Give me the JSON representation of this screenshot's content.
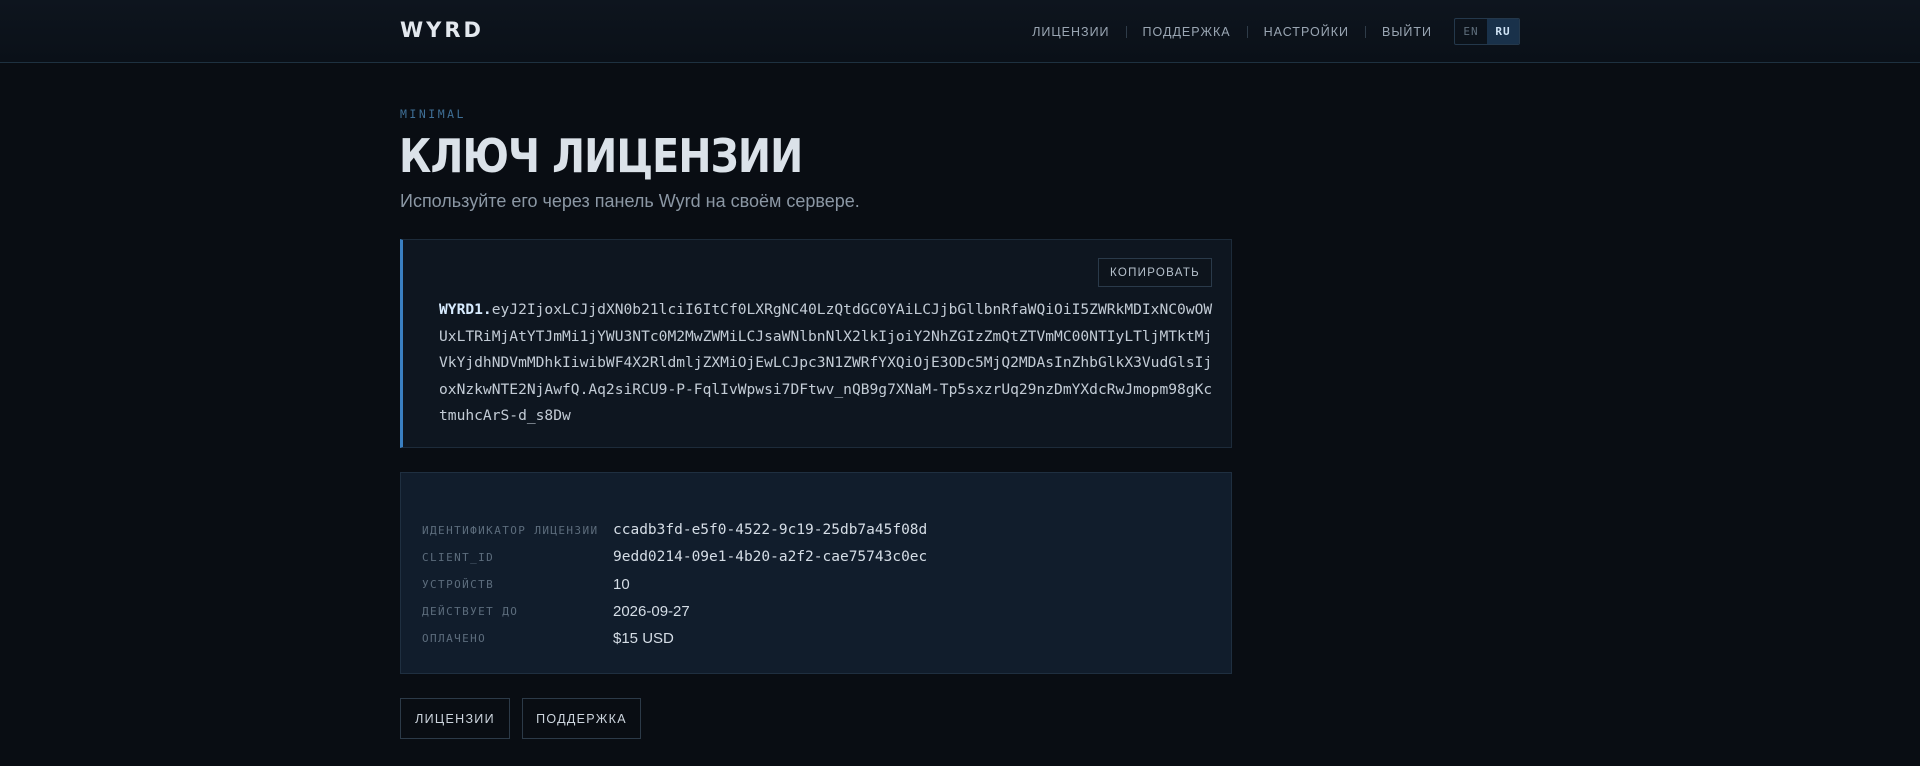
{
  "header": {
    "logo": "WYRD",
    "nav": [
      {
        "label": "ЛИЦЕНЗИИ"
      },
      {
        "label": "ПОДДЕРЖКА"
      },
      {
        "label": "НАСТРОЙКИ"
      },
      {
        "label": "ВЫЙТИ"
      }
    ],
    "languages": [
      {
        "code": "EN",
        "active": false
      },
      {
        "code": "RU",
        "active": true
      }
    ]
  },
  "hero": {
    "eyebrow": "MINIMAL",
    "title": "КЛЮЧ ЛИЦЕНЗИИ",
    "subtitle": "Используйте его через панель Wyrd на своём сервере."
  },
  "license_key": {
    "copy_label": "КОПИРОВАТЬ",
    "prefix": "WYRD1.",
    "body": "eyJ2IjoxLCJjdXN0b21lciI6ItCf0LXRgNC40LzQtdGC0YAiLCJjbGllbnRfaWQiOiI5ZWRkMDIxNC0wOWUxLTRiMjAtYTJmMi1jYWU3NTc0M2MwZWMiLCJsaWNlbnNlX2lkIjoiY2NhZGIzZmQtZTVmMC00NTIyLTljMTktMjVkYjdhNDVmMDhkIiwibWF4X2RldmljZXMiOjEwLCJpc3N1ZWRfYXQiOjE3ODc5MjQ2MDAsInZhbGlkX3VudGlsIjoxNzkwNTE2NjAwfQ.Aq2siRCU9-P-FqlIvWpwsi7DFtwv_nQB9g7XNaM-Tp5sxzrUq29nzDmYXdcRwJmopm98gKctmuhcArS-d_s8Dw"
  },
  "info": {
    "rows": [
      {
        "label": "ИДЕНТИФИКАТОР ЛИЦЕНЗИИ",
        "value": "ccadb3fd-e5f0-4522-9c19-25db7a45f08d"
      },
      {
        "label": "CLIENT_ID",
        "value": "9edd0214-09e1-4b20-a2f2-cae75743c0ec"
      },
      {
        "label": "УСТРОЙСТВ",
        "value": "10"
      },
      {
        "label": "ДЕЙСТВУЕТ ДО",
        "value": "2026-09-27"
      },
      {
        "label": "ОПЛАЧЕНО",
        "value": "$15 USD"
      }
    ]
  },
  "actions": {
    "licenses_label": "ЛИЦЕНЗИИ",
    "support_label": "ПОДДЕРЖКА"
  }
}
